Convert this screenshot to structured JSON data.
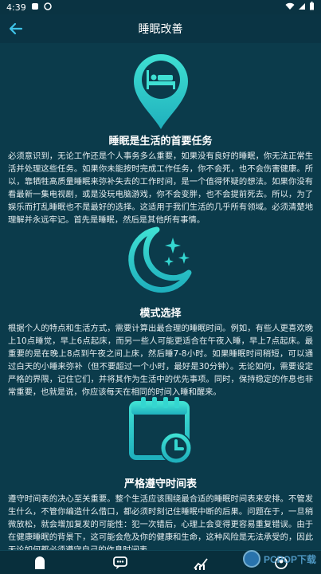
{
  "status_bar": {
    "time": "4:39",
    "icon_names": [
      "notification-a-icon",
      "notification-b-icon",
      "wifi-icon",
      "signal-icon",
      "battery-icon"
    ]
  },
  "app_bar": {
    "title": "睡眠改善",
    "back_icon": "arrow-left-icon"
  },
  "sections": [
    {
      "icon": "bed-location-pin-icon",
      "title": "睡眠是生活的首要任务",
      "body": "必须意识到，无论工作还是个人事务多么重要，如果没有良好的睡眠，你无法正常生活并处理这些任务。如果你未能按时完成工作任务，你不会死，也不会伤害健康。所以，靠牺牲高质量睡眠来弥补失去的工作时间，是一个值得怀疑的想法。如果你没有看最新一集电视剧，或是没玩电脑游戏，你不会变胖，也不会提前死去。所以，为了娱乐而打乱睡眠也不是最好的选择。这适用于我们生活的几乎所有领域。必须清楚地理解并永远牢记。首先是睡眠，然后是其他所有事情。"
    },
    {
      "icon": "moon-stars-icon",
      "title": "模式选择",
      "body": "根据个人的特点和生活方式，需要计算出最合理的睡眠时间。例如，有些人更喜欢晚上10点睡觉，早上6点起床，而另一些人可能更适合在午夜入睡，早上7点起床。最重要的是在晚上8点到午夜之间上床，然后睡7-8小时。如果睡眠时间稍短，可以通过白天的小睡来弥补（但不要超过一个小时，最好是30分钟）。无论如何，需要设定严格的界限，记住它们，并将其作为生活中的优先事项。同时，保持稳定的作息也非常重要，也就是说，你应该每天在相同的时间入睡和醒来。"
    },
    {
      "icon": "calendar-clock-icon",
      "title": "严格遵守时间表",
      "body": "遵守时间表的决心至关重要。整个生活应该围绕最合适的睡眠时间表来安排。不管发生什么，不管你编造什么借口，都必须时刻记住睡眠中断的后果。问题在于，一旦稍微放松，就会增加复发的可能性：犯一次错后，心理上会变得更容易重复错误。由于在健康睡眠的背景下，这可能会危及你的健康和生命，这种风险是无法承受的，因此无论如何都必须遵守自己的作息时间表。"
    }
  ],
  "bottom_nav": {
    "items": [
      {
        "icon": "home-icon"
      },
      {
        "icon": "chat-icon"
      },
      {
        "icon": "stats-icon"
      },
      {
        "icon": "profile-icon"
      }
    ]
  },
  "watermark": {
    "text": "PCPOP下载"
  },
  "colors": {
    "background": "#0b3b4b",
    "accent": "#29c9c7",
    "accent_light": "#34d6d0"
  }
}
